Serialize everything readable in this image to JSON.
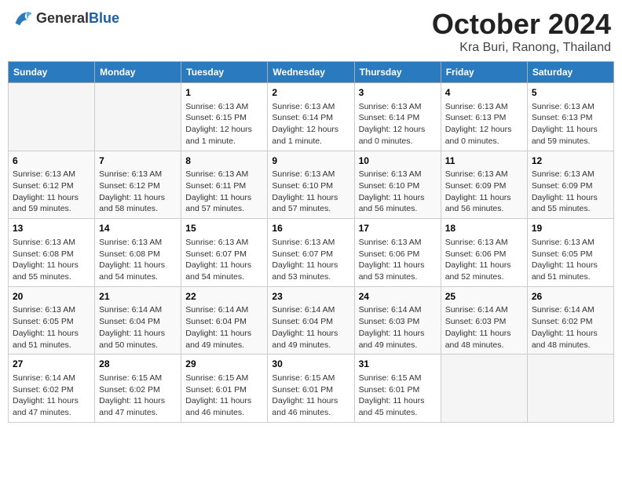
{
  "header": {
    "logo_line1": "General",
    "logo_line2": "Blue",
    "month_year": "October 2024",
    "location": "Kra Buri, Ranong, Thailand"
  },
  "days_of_week": [
    "Sunday",
    "Monday",
    "Tuesday",
    "Wednesday",
    "Thursday",
    "Friday",
    "Saturday"
  ],
  "weeks": [
    [
      {
        "day": "",
        "info": ""
      },
      {
        "day": "",
        "info": ""
      },
      {
        "day": "1",
        "info": "Sunrise: 6:13 AM\nSunset: 6:15 PM\nDaylight: 12 hours and 1 minute."
      },
      {
        "day": "2",
        "info": "Sunrise: 6:13 AM\nSunset: 6:14 PM\nDaylight: 12 hours and 1 minute."
      },
      {
        "day": "3",
        "info": "Sunrise: 6:13 AM\nSunset: 6:14 PM\nDaylight: 12 hours and 0 minutes."
      },
      {
        "day": "4",
        "info": "Sunrise: 6:13 AM\nSunset: 6:13 PM\nDaylight: 12 hours and 0 minutes."
      },
      {
        "day": "5",
        "info": "Sunrise: 6:13 AM\nSunset: 6:13 PM\nDaylight: 11 hours and 59 minutes."
      }
    ],
    [
      {
        "day": "6",
        "info": "Sunrise: 6:13 AM\nSunset: 6:12 PM\nDaylight: 11 hours and 59 minutes."
      },
      {
        "day": "7",
        "info": "Sunrise: 6:13 AM\nSunset: 6:12 PM\nDaylight: 11 hours and 58 minutes."
      },
      {
        "day": "8",
        "info": "Sunrise: 6:13 AM\nSunset: 6:11 PM\nDaylight: 11 hours and 57 minutes."
      },
      {
        "day": "9",
        "info": "Sunrise: 6:13 AM\nSunset: 6:10 PM\nDaylight: 11 hours and 57 minutes."
      },
      {
        "day": "10",
        "info": "Sunrise: 6:13 AM\nSunset: 6:10 PM\nDaylight: 11 hours and 56 minutes."
      },
      {
        "day": "11",
        "info": "Sunrise: 6:13 AM\nSunset: 6:09 PM\nDaylight: 11 hours and 56 minutes."
      },
      {
        "day": "12",
        "info": "Sunrise: 6:13 AM\nSunset: 6:09 PM\nDaylight: 11 hours and 55 minutes."
      }
    ],
    [
      {
        "day": "13",
        "info": "Sunrise: 6:13 AM\nSunset: 6:08 PM\nDaylight: 11 hours and 55 minutes."
      },
      {
        "day": "14",
        "info": "Sunrise: 6:13 AM\nSunset: 6:08 PM\nDaylight: 11 hours and 54 minutes."
      },
      {
        "day": "15",
        "info": "Sunrise: 6:13 AM\nSunset: 6:07 PM\nDaylight: 11 hours and 54 minutes."
      },
      {
        "day": "16",
        "info": "Sunrise: 6:13 AM\nSunset: 6:07 PM\nDaylight: 11 hours and 53 minutes."
      },
      {
        "day": "17",
        "info": "Sunrise: 6:13 AM\nSunset: 6:06 PM\nDaylight: 11 hours and 53 minutes."
      },
      {
        "day": "18",
        "info": "Sunrise: 6:13 AM\nSunset: 6:06 PM\nDaylight: 11 hours and 52 minutes."
      },
      {
        "day": "19",
        "info": "Sunrise: 6:13 AM\nSunset: 6:05 PM\nDaylight: 11 hours and 51 minutes."
      }
    ],
    [
      {
        "day": "20",
        "info": "Sunrise: 6:13 AM\nSunset: 6:05 PM\nDaylight: 11 hours and 51 minutes."
      },
      {
        "day": "21",
        "info": "Sunrise: 6:14 AM\nSunset: 6:04 PM\nDaylight: 11 hours and 50 minutes."
      },
      {
        "day": "22",
        "info": "Sunrise: 6:14 AM\nSunset: 6:04 PM\nDaylight: 11 hours and 49 minutes."
      },
      {
        "day": "23",
        "info": "Sunrise: 6:14 AM\nSunset: 6:04 PM\nDaylight: 11 hours and 49 minutes."
      },
      {
        "day": "24",
        "info": "Sunrise: 6:14 AM\nSunset: 6:03 PM\nDaylight: 11 hours and 49 minutes."
      },
      {
        "day": "25",
        "info": "Sunrise: 6:14 AM\nSunset: 6:03 PM\nDaylight: 11 hours and 48 minutes."
      },
      {
        "day": "26",
        "info": "Sunrise: 6:14 AM\nSunset: 6:02 PM\nDaylight: 11 hours and 48 minutes."
      }
    ],
    [
      {
        "day": "27",
        "info": "Sunrise: 6:14 AM\nSunset: 6:02 PM\nDaylight: 11 hours and 47 minutes."
      },
      {
        "day": "28",
        "info": "Sunrise: 6:15 AM\nSunset: 6:02 PM\nDaylight: 11 hours and 47 minutes."
      },
      {
        "day": "29",
        "info": "Sunrise: 6:15 AM\nSunset: 6:01 PM\nDaylight: 11 hours and 46 minutes."
      },
      {
        "day": "30",
        "info": "Sunrise: 6:15 AM\nSunset: 6:01 PM\nDaylight: 11 hours and 46 minutes."
      },
      {
        "day": "31",
        "info": "Sunrise: 6:15 AM\nSunset: 6:01 PM\nDaylight: 11 hours and 45 minutes."
      },
      {
        "day": "",
        "info": ""
      },
      {
        "day": "",
        "info": ""
      }
    ]
  ]
}
